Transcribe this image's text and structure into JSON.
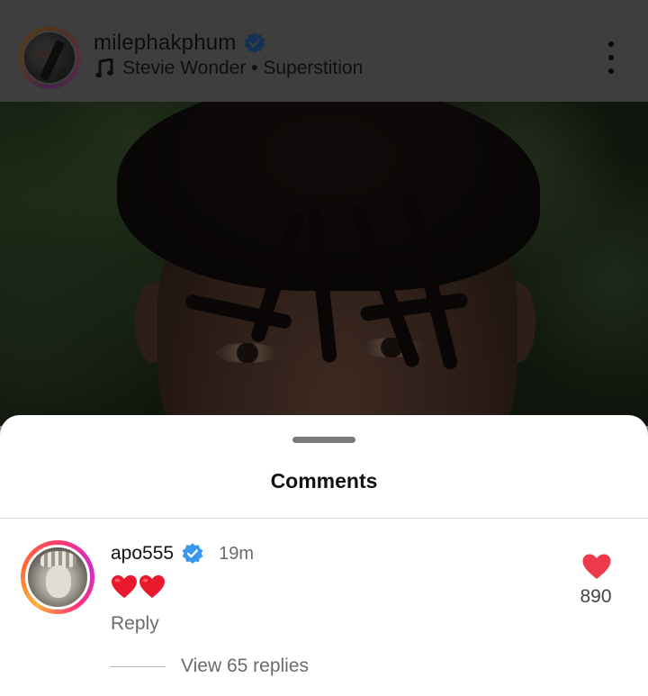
{
  "post": {
    "username": "milephakphum",
    "music": "Stevie Wonder • Superstition",
    "icons": {
      "verified": "verified-badge-icon",
      "music": "music-note-icon",
      "more": "more-options-icon"
    }
  },
  "sheet": {
    "title": "Comments"
  },
  "comments": [
    {
      "username": "apo555",
      "time": "19m",
      "text": "❤️❤️",
      "reply_label": "Reply",
      "like_count": "890",
      "view_replies": "View 65 replies"
    }
  ],
  "colors": {
    "verified_blue": "#3897f0",
    "like_red": "#ed3a4a",
    "story_ring": "#d12ccf"
  }
}
